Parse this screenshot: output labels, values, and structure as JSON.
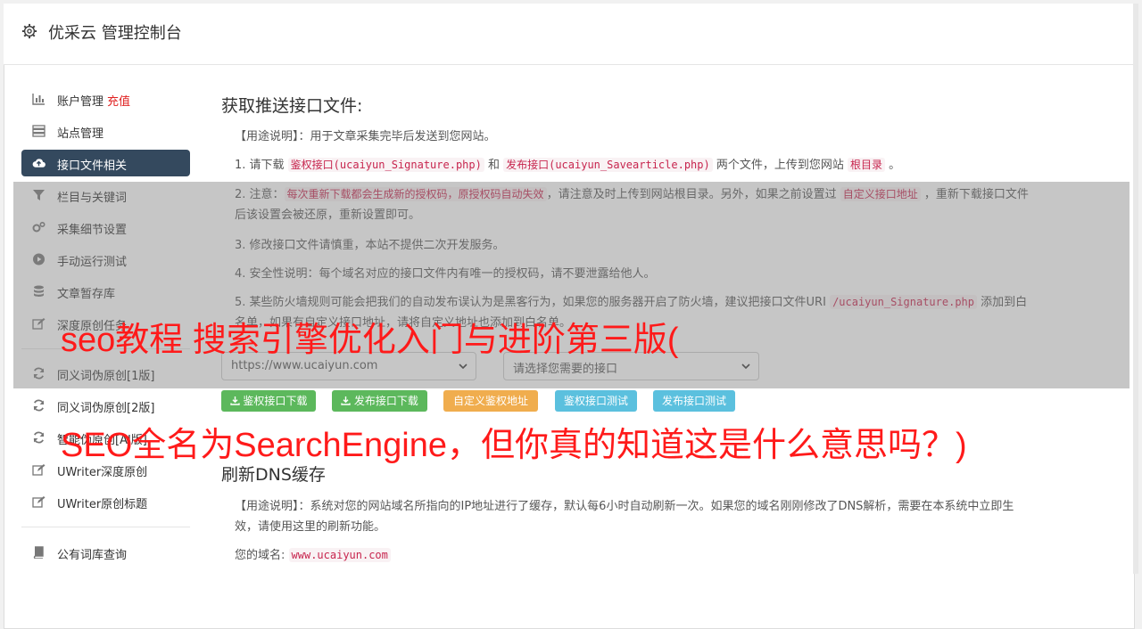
{
  "header": {
    "title": "优采云 管理控制台"
  },
  "sidebar": {
    "items": [
      {
        "label": "账户管理",
        "extra": "充值"
      },
      {
        "label": "站点管理"
      },
      {
        "label": "接口文件相关"
      },
      {
        "label": "栏目与关键词"
      },
      {
        "label": "采集细节设置"
      },
      {
        "label": "手动运行测试"
      },
      {
        "label": "文章暂存库"
      },
      {
        "label": "深度原创任务"
      },
      {
        "label": "同义词伪原创[1版]"
      },
      {
        "label": "同义词伪原创[2版]"
      },
      {
        "label": "智能伪原创[AI版]"
      },
      {
        "label": "UWriter深度原创"
      },
      {
        "label": "UWriter原创标题"
      },
      {
        "label": "公有词库查询"
      }
    ]
  },
  "main": {
    "section1": {
      "title": "获取推送接口文件:",
      "usage": "【用途说明】：用于文章采集完毕后发送到您网站。",
      "step1": {
        "a": "1. 请下载 ",
        "code1": "鉴权接口(ucaiyun_Signature.php)",
        "b": " 和 ",
        "code2": "发布接口(ucaiyun_Savearticle.php)",
        "c": " 两个文件，上传到您网站 ",
        "code3": "根目录",
        "d": " 。"
      },
      "step2": {
        "a": "2. 注意：",
        "code1": "每次重新下载都会生成新的授权码，原授权码自动失效",
        "b": "，请注意及时上传到网站根目录。另外，如果之前设置过 ",
        "code2": "自定义接口地址",
        "c": " ，重新下载接口文件后该设置会被还原，重新设置即可。"
      },
      "step3": "3. 修改接口文件请慎重，本站不提供二次开发服务。",
      "step4": "4. 安全性说明：每个域名对应的接口文件内有唯一的授权码，请不要泄露给他人。",
      "step5": {
        "a": "5. 某些防火墙规则可能会把我们的自动发布误认为是黑客行为，如果您的服务器开启了防火墙，建议把接口文件URI ",
        "code1": "/ucaiyun_Signature.php",
        "b": " 添加到白名单，如果有自定义接口地址，请将自定义地址也添加到白名单。"
      },
      "site_select": "https://www.ucaiyun.com",
      "api_select": "请选择您需要的接口",
      "buttons": [
        "鉴权接口下载",
        "发布接口下载",
        "自定义鉴权地址",
        "鉴权接口测试",
        "发布接口测试"
      ]
    },
    "section2": {
      "title": "刷新DNS缓存",
      "usage": "【用途说明】：系统对您的网站域名所指向的IP地址进行了缓存，默认每6小时自动刷新一次。如果您的域名刚刚修改了DNS解析，需要在本系统中立即生效，请使用这里的刷新功能。",
      "domain_label": "您的域名: ",
      "domain_value": "www.ucaiyun.com"
    }
  },
  "overlay_text": {
    "line1": "seo教程 搜索引擎优化入门与进阶第三版(",
    "line2": "SEO全名为SearchEngine，但你真的知道这是什么意思吗？)"
  },
  "colors": {
    "accent": "#34495e",
    "green": "#5cb85c",
    "orange": "#f0ad4e",
    "blue": "#5bc0de",
    "overlay_text": "#ff1a1a"
  }
}
